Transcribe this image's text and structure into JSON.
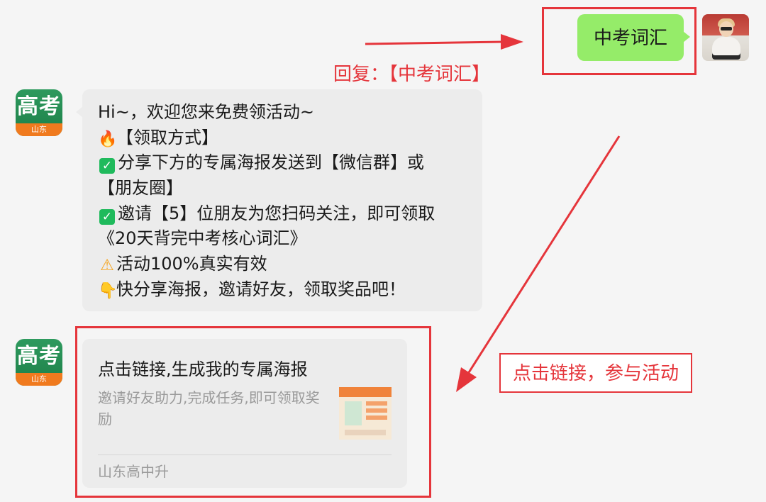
{
  "user_message": {
    "text": "中考词汇"
  },
  "reply_annotation": {
    "text": "回复：【中考词汇】"
  },
  "bot": {
    "avatar_brand": "高考",
    "avatar_sub": "山东"
  },
  "bot_message": {
    "lines": [
      {
        "icon": "",
        "text": "Hi~，欢迎您来免费领活动~"
      },
      {
        "icon": "fire-icon",
        "glyph": "🔥",
        "text": "【领取方式】"
      },
      {
        "icon": "check-icon",
        "glyph": "✓",
        "text": "分享下方的专属海报发送到【微信群】或"
      },
      {
        "icon": "",
        "text": "【朋友圈】"
      },
      {
        "icon": "check-icon",
        "glyph": "✓",
        "text": "邀请【5】位朋友为您扫码关注，即可领取"
      },
      {
        "icon": "",
        "text": "《20天背完中考核心词汇》"
      },
      {
        "icon": "warning-icon",
        "glyph": "⚠",
        "text": "活动100%真实有效"
      },
      {
        "icon": "pointing-hand-icon",
        "glyph": "👇",
        "text": "快分享海报，邀请好友，领取奖品吧！"
      }
    ]
  },
  "link_card": {
    "title": "点击链接,生成我的专属海报",
    "description": "邀请好友助力,完成任务,即可领取奖励",
    "source": "山东高中升"
  },
  "click_annotation": {
    "text": "点击链接，参与活动"
  },
  "colors": {
    "accent_red": "#e5353b",
    "user_bubble": "#95ec69",
    "bot_bubble": "#ececec",
    "brand_green": "#1d7f48",
    "brand_orange": "#f07a1e"
  }
}
